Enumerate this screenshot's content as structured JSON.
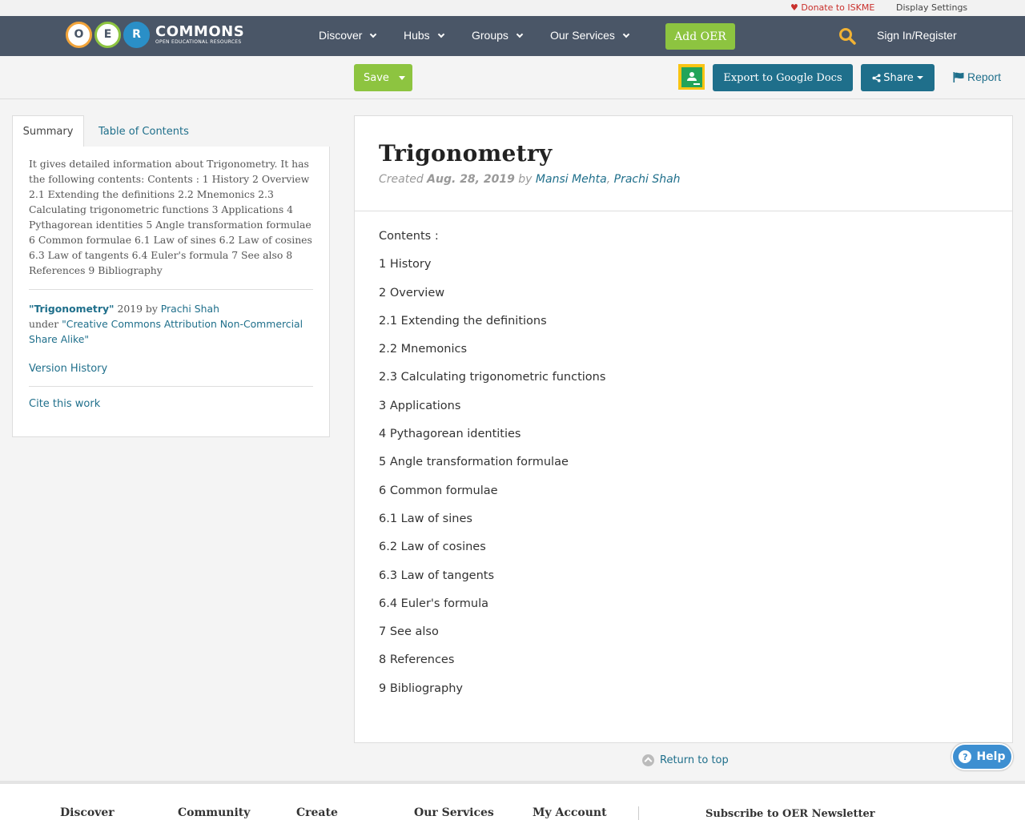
{
  "utility": {
    "donate": "Donate to ISKME",
    "display_settings": "Display Settings"
  },
  "logo": {
    "letters": [
      "O",
      "E",
      "R"
    ],
    "word": "COMMONS",
    "tagline": "OPEN EDUCATIONAL RESOURCES"
  },
  "nav": {
    "items": [
      "Discover",
      "Hubs",
      "Groups",
      "Our Services"
    ],
    "add_oer": "Add OER",
    "sign_in": "Sign In/Register"
  },
  "toolbar": {
    "save": "Save",
    "export": "Export to Google Docs",
    "share": "Share",
    "report": "Report"
  },
  "tabs": {
    "summary": "Summary",
    "toc": "Table of Contents"
  },
  "summary": {
    "text": "It gives detailed information about Trigonometry. It has the following contents: Contents : 1 History 2 Overview 2.1 Extending the definitions 2.2 Mnemonics 2.3 Calculating trigonometric functions 3 Applications 4 Pythagorean identities 5 Angle transformation formulae 6 Common formulae 6.1 Law of sines 6.2 Law of cosines 6.3 Law of tangents 6.4 Euler's formula 7 See also 8 References 9 Bibliography",
    "attr_title": "\"Trigonometry\"",
    "attr_year_by": " 2019 by ",
    "attr_author": "Prachi Shah",
    "attr_under": "under ",
    "attr_license": "\"Creative Commons Attribution Non-Commercial Share Alike\"",
    "version_history": "Version History",
    "cite": "Cite this work"
  },
  "resource": {
    "title": "Trigonometry",
    "created_label": "Created ",
    "created_date": "Aug. 28, 2019",
    "by": " by ",
    "author1": "Mansi Mehta",
    "comma": ", ",
    "author2": "Prachi Shah",
    "contents": [
      "Contents :",
      "1 History",
      "2 Overview",
      "2.1 Extending the definitions",
      "2.2 Mnemonics",
      "2.3 Calculating trigonometric functions",
      "3 Applications",
      "4 Pythagorean identities",
      "5 Angle transformation formulae",
      "6 Common formulae",
      "6.1 Law of sines",
      "6.2 Law of cosines",
      "6.3 Law of tangents",
      "6.4 Euler's formula",
      "7 See also",
      "8 References",
      "9 Bibliography"
    ]
  },
  "return_top": "Return to top",
  "help": "Help",
  "footer": {
    "columns": [
      "Discover",
      "Community",
      "Create",
      "Our Services",
      "My Account"
    ],
    "newsletter": "Subscribe to OER Newsletter"
  },
  "colors": {
    "nav_bg": "#4a5667",
    "green": "#8dc440",
    "teal": "#1f6f8b",
    "donate_red": "#c9302c",
    "search_icon": "#f2b233"
  }
}
